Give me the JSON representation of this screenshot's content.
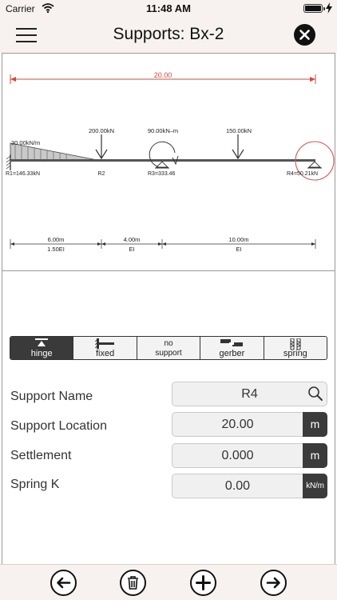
{
  "status_bar": {
    "carrier": "Carrier",
    "time": "11:48 AM"
  },
  "nav": {
    "title": "Supports: Bx-2",
    "menu_icon": "hamburger-menu-icon",
    "close_icon": "close-x-icon"
  },
  "diagram": {
    "total_length": "20.00",
    "dist_load": "30.00kN/m",
    "point_load_1": "200.00kN",
    "moment": "90.00kN–m",
    "point_load_2": "150.00kN",
    "supports": [
      "R1=146.33kN",
      "R2",
      "R3=333.46",
      "R4=50.21kN"
    ],
    "spans": [
      {
        "length": "6.00m",
        "stiffness": "1.50EI"
      },
      {
        "length": "4.00m",
        "stiffness": "EI"
      },
      {
        "length": "10.00m",
        "stiffness": "EI"
      }
    ],
    "highlight_color": "#d9534f",
    "dimension_color": "#e0433a"
  },
  "support_types": [
    {
      "label": "hinge",
      "icon": "hinge-icon",
      "active": true
    },
    {
      "label": "fixed",
      "icon": "fixed-icon",
      "active": false
    },
    {
      "label": "no support",
      "line1": "no",
      "line2": "support",
      "active": false
    },
    {
      "label": "gerber",
      "icon": "gerber-icon",
      "active": false
    },
    {
      "label": "spring",
      "icon": "spring-icon",
      "active": false
    }
  ],
  "form": {
    "support_name": {
      "label": "Support Name",
      "value": "R4"
    },
    "support_location": {
      "label": "Support Location",
      "value": "20.00",
      "unit": "m"
    },
    "settlement": {
      "label": "Settlement",
      "value": "0.000",
      "unit": "m"
    },
    "spring_k": {
      "label": "Spring K",
      "value": "0.00",
      "unit": "kN/m"
    }
  },
  "toolbar": [
    "arrow-left-icon",
    "trash-icon",
    "plus-icon",
    "arrow-right-icon"
  ]
}
